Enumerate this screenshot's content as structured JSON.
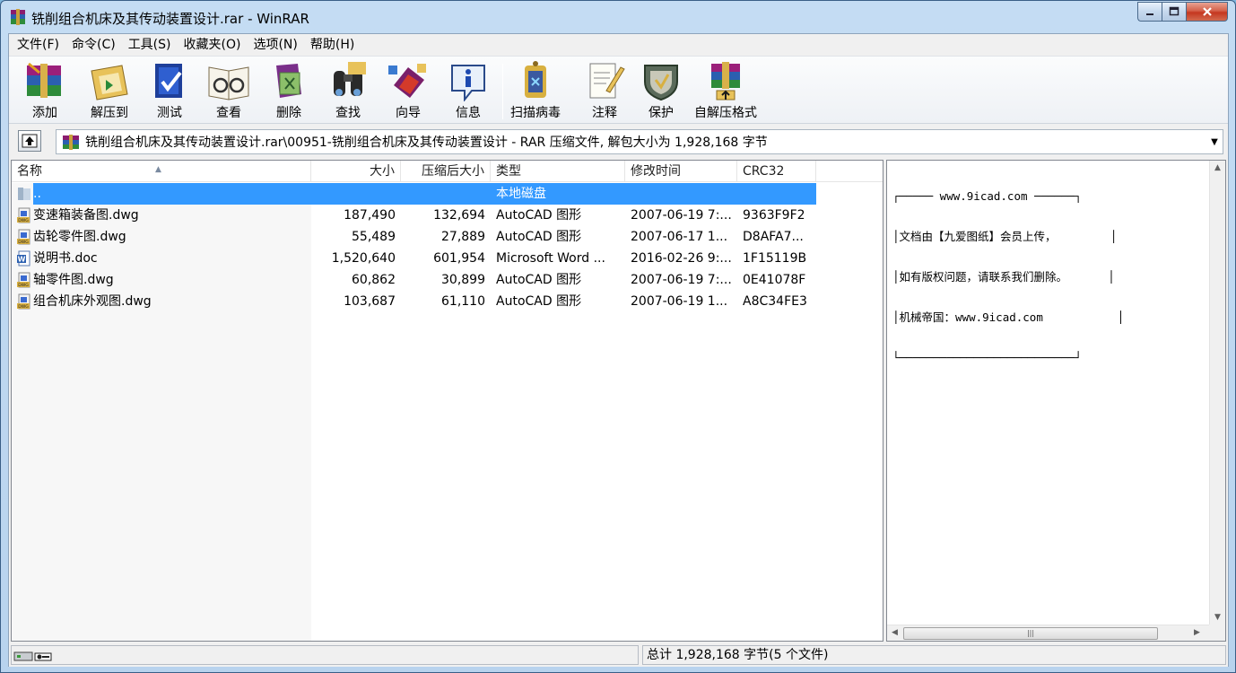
{
  "window": {
    "title": "铣削组合机床及其传动装置设计.rar - WinRAR",
    "controls": {
      "minimize": "minimize-icon",
      "maximize": "maximize-icon",
      "close": "close-icon"
    }
  },
  "menu": [
    "文件(F)",
    "命令(C)",
    "工具(S)",
    "收藏夹(O)",
    "选项(N)",
    "帮助(H)"
  ],
  "toolbar": [
    {
      "label": "添加",
      "icon": "add-archive-icon"
    },
    {
      "label": "解压到",
      "icon": "extract-to-icon"
    },
    {
      "label": "测试",
      "icon": "test-icon"
    },
    {
      "label": "查看",
      "icon": "view-icon"
    },
    {
      "label": "删除",
      "icon": "delete-icon"
    },
    {
      "label": "查找",
      "icon": "find-icon"
    },
    {
      "label": "向导",
      "icon": "wizard-icon"
    },
    {
      "label": "信息",
      "icon": "info-icon"
    },
    {
      "label": "扫描病毒",
      "icon": "virus-scan-icon"
    },
    {
      "label": "注释",
      "icon": "comment-icon"
    },
    {
      "label": "保护",
      "icon": "protect-icon"
    },
    {
      "label": "自解压格式",
      "icon": "sfx-icon"
    }
  ],
  "address": {
    "path": "铣削组合机床及其传动装置设计.rar\\00951-铣削组合机床及其传动装置设计 - RAR 压缩文件, 解包大小为 1,928,168 字节"
  },
  "columns": {
    "name": "名称",
    "size": "大小",
    "packed": "压缩后大小",
    "type": "类型",
    "modified": "修改时间",
    "crc": "CRC32"
  },
  "files": [
    {
      "name": "..",
      "size": "",
      "packed": "",
      "type": "本地磁盘",
      "modified": "",
      "crc": "",
      "icon": "folder-up-icon",
      "selected": true
    },
    {
      "name": "变速箱装备图.dwg",
      "size": "187,490",
      "packed": "132,694",
      "type": "AutoCAD 图形",
      "modified": "2007-06-19 7:...",
      "crc": "9363F9F2",
      "icon": "dwg-file-icon"
    },
    {
      "name": "齿轮零件图.dwg",
      "size": "55,489",
      "packed": "27,889",
      "type": "AutoCAD 图形",
      "modified": "2007-06-17 1...",
      "crc": "D8AFA7...",
      "icon": "dwg-file-icon"
    },
    {
      "name": "说明书.doc",
      "size": "1,520,640",
      "packed": "601,954",
      "type": "Microsoft Word ...",
      "modified": "2016-02-26 9:...",
      "crc": "1F15119B",
      "icon": "word-doc-icon"
    },
    {
      "name": "轴零件图.dwg",
      "size": "60,862",
      "packed": "30,899",
      "type": "AutoCAD 图形",
      "modified": "2007-06-19 7:...",
      "crc": "0E41078F",
      "icon": "dwg-file-icon"
    },
    {
      "name": "组合机床外观图.dwg",
      "size": "103,687",
      "packed": "61,110",
      "type": "AutoCAD 图形",
      "modified": "2007-06-19 1...",
      "crc": "A8C34FE3",
      "icon": "dwg-file-icon"
    }
  ],
  "comment": {
    "lines": [
      "┌───── www.9icad.com ──────┐",
      "│文档由【九爱图纸】会员上传，        │",
      "│如有版权问题，请联系我们删除。      │",
      "│机械帝国：www.9icad.com           │",
      "└──────────────────────────┘"
    ]
  },
  "status": {
    "total": "总计 1,928,168 字节(5 个文件)"
  }
}
